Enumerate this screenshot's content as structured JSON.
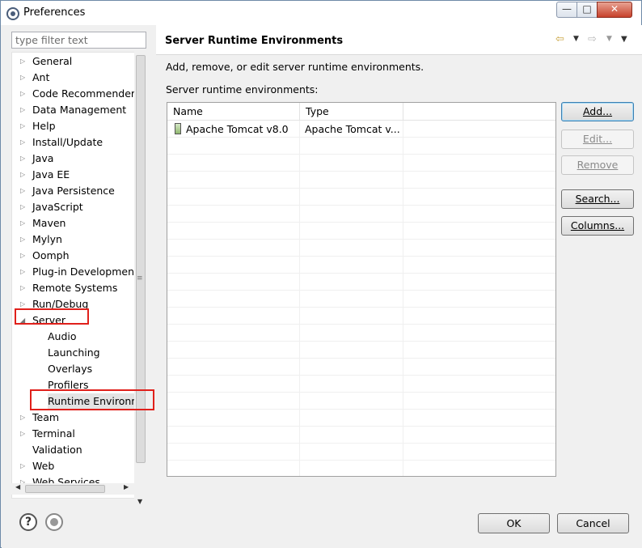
{
  "window": {
    "title": "Preferences",
    "min_glyph": "—",
    "max_glyph": "□",
    "close_glyph": "✕"
  },
  "filter": {
    "placeholder": "type filter text"
  },
  "tree": {
    "items": [
      {
        "label": "General",
        "expanded": false
      },
      {
        "label": "Ant",
        "expanded": false
      },
      {
        "label": "Code Recommenders",
        "expanded": false
      },
      {
        "label": "Data Management",
        "expanded": false
      },
      {
        "label": "Help",
        "expanded": false
      },
      {
        "label": "Install/Update",
        "expanded": false
      },
      {
        "label": "Java",
        "expanded": false
      },
      {
        "label": "Java EE",
        "expanded": false
      },
      {
        "label": "Java Persistence",
        "expanded": false
      },
      {
        "label": "JavaScript",
        "expanded": false
      },
      {
        "label": "Maven",
        "expanded": false
      },
      {
        "label": "Mylyn",
        "expanded": false
      },
      {
        "label": "Oomph",
        "expanded": false
      },
      {
        "label": "Plug-in Development",
        "expanded": false
      },
      {
        "label": "Remote Systems",
        "expanded": false
      },
      {
        "label": "Run/Debug",
        "expanded": false
      },
      {
        "label": "Server",
        "expanded": true
      },
      {
        "label": "Audio",
        "child": true
      },
      {
        "label": "Launching",
        "child": true
      },
      {
        "label": "Overlays",
        "child": true
      },
      {
        "label": "Profilers",
        "child": true
      },
      {
        "label": "Runtime Environm",
        "child": true,
        "selected": true
      },
      {
        "label": "Team",
        "expanded": false
      },
      {
        "label": "Terminal",
        "expanded": false
      },
      {
        "label": "Validation",
        "leaf": true
      },
      {
        "label": "Web",
        "expanded": false
      },
      {
        "label": "Web Services",
        "expanded": false
      }
    ]
  },
  "page": {
    "title": "Server Runtime Environments",
    "description": "Add, remove, or edit server runtime environments.",
    "subtitle": "Server runtime environments:",
    "nav": {
      "back": "⇦",
      "forward": "⇨",
      "dropdown": "▼",
      "menu": "▼"
    }
  },
  "table": {
    "columns": [
      "Name",
      "Type"
    ],
    "rows": [
      {
        "name": "Apache Tomcat v8.0",
        "type": "Apache Tomcat v..."
      }
    ]
  },
  "buttons": {
    "add": "Add...",
    "edit": "Edit...",
    "remove": "Remove",
    "search": "Search...",
    "columns": "Columns..."
  },
  "dialog": {
    "ok": "OK",
    "cancel": "Cancel",
    "help": "?"
  },
  "colors": {
    "highlight": "#e0201b",
    "accent": "#3c7fb1"
  }
}
